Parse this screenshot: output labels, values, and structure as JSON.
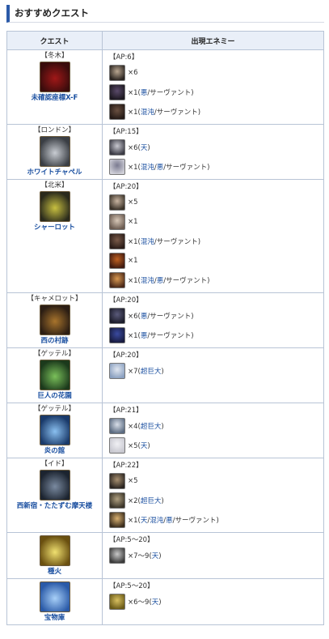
{
  "heading": "おすすめクエスト",
  "columns": {
    "quest": "クエスト",
    "enemy": "出現エネミー"
  },
  "rows": [
    {
      "region": "【冬木】",
      "name": "未確認座標X-F",
      "thumb_colors": [
        "#3a0c0c",
        "#a01818"
      ],
      "ap": "【AP:6】",
      "enemies": [
        {
          "icon": [
            "#2a2420",
            "#b9a690"
          ],
          "count": "×6",
          "cls": [],
          "suffix": ""
        },
        {
          "icon": [
            "#1c1820",
            "#5a4a6a"
          ],
          "count": "×1(",
          "cls": [
            "悪"
          ],
          "suffix": "/サーヴァント)"
        },
        {
          "icon": [
            "#241a16",
            "#6a5040"
          ],
          "count": "×1(",
          "cls": [
            "混沌"
          ],
          "suffix": "/サーヴァント)"
        }
      ]
    },
    {
      "region": "【ロンドン】",
      "name": "ホワイトチャペル",
      "thumb_colors": [
        "#3a3e44",
        "#c8ccd2"
      ],
      "ap": "【AP:15】",
      "enemies": [
        {
          "icon": [
            "#3a3a44",
            "#c8c8d0"
          ],
          "count": "×6(",
          "cls": [
            "天"
          ],
          "suffix": ")"
        },
        {
          "icon": [
            "#d0d0d8",
            "#7a7a90"
          ],
          "count": "×1(",
          "cls": [
            "混沌",
            "悪"
          ],
          "suffix": "/サーヴァント)"
        }
      ]
    },
    {
      "region": "【北米】",
      "name": "シャーロット",
      "thumb_colors": [
        "#2a2a1c",
        "#c8c040"
      ],
      "ap": "【AP:20】",
      "enemies": [
        {
          "icon": [
            "#3a3228",
            "#c8b4a0"
          ],
          "count": "×5",
          "cls": [],
          "suffix": ""
        },
        {
          "icon": [
            "#6a5a50",
            "#d8c8b8"
          ],
          "count": "×1",
          "cls": [],
          "suffix": ""
        },
        {
          "icon": [
            "#2a1c18",
            "#7a5a48"
          ],
          "count": "×1(",
          "cls": [
            "混沌"
          ],
          "suffix": "/サーヴァント)"
        },
        {
          "icon": [
            "#401a10",
            "#c06020"
          ],
          "count": "×1",
          "cls": [],
          "suffix": ""
        },
        {
          "icon": [
            "#4a2818",
            "#d89850"
          ],
          "count": "×1(",
          "cls": [
            "混沌",
            "悪"
          ],
          "suffix": "/サーヴァント)"
        }
      ]
    },
    {
      "region": "【キャメロット】",
      "name": "西の村跡",
      "thumb_colors": [
        "#2c1e14",
        "#a8742c"
      ],
      "ap": "【AP:20】",
      "enemies": [
        {
          "icon": [
            "#1c1c2a",
            "#5a5a7a"
          ],
          "count": "×6(",
          "cls": [
            "悪"
          ],
          "suffix": "/サーヴァント)"
        },
        {
          "icon": [
            "#181c40",
            "#3a4aa0"
          ],
          "count": "×1(",
          "cls": [
            "悪"
          ],
          "suffix": "/サーヴァント)"
        }
      ]
    },
    {
      "region": "【ゲッテル】",
      "name": "巨人の花園",
      "thumb_colors": [
        "#1c3a1c",
        "#7ac05a"
      ],
      "ap": "【AP:20】",
      "enemies": [
        {
          "icon": [
            "#8aa0c0",
            "#e0e6f0"
          ],
          "count": "×7(",
          "cls": [
            "超巨大"
          ],
          "suffix": ")"
        }
      ]
    },
    {
      "region": "【ゲッテル】",
      "name": "炎の館",
      "thumb_colors": [
        "#1a3a6a",
        "#8ac0f0"
      ],
      "ap": "【AP:21】",
      "enemies": [
        {
          "icon": [
            "#5a6a80",
            "#d8dee8"
          ],
          "count": "×4(",
          "cls": [
            "超巨大"
          ],
          "suffix": ")"
        },
        {
          "icon": [
            "#c8c8d0",
            "#f0f0f4"
          ],
          "count": "×5(",
          "cls": [
            "天"
          ],
          "suffix": ")"
        }
      ]
    },
    {
      "region": "【イド】",
      "name": "西新宿・たたずむ摩天楼",
      "thumb_colors": [
        "#1c2430",
        "#7a8aa0"
      ],
      "ap": "【AP:22】",
      "enemies": [
        {
          "icon": [
            "#2a2420",
            "#a89070"
          ],
          "count": "×5",
          "cls": [],
          "suffix": ""
        },
        {
          "icon": [
            "#3a3428",
            "#b0a080"
          ],
          "count": "×2(",
          "cls": [
            "超巨大"
          ],
          "suffix": ")"
        },
        {
          "icon": [
            "#3a2c1c",
            "#d8b070"
          ],
          "count": "×1(",
          "cls": [
            "天",
            "混沌",
            "悪"
          ],
          "suffix": "/サーヴァント)"
        }
      ]
    },
    {
      "region": "",
      "name": "種火",
      "thumb_colors": [
        "#6a5010",
        "#f0e070"
      ],
      "ap": "【AP:5～20】",
      "enemies": [
        {
          "icon": [
            "#3a3a3a",
            "#c8c8c8"
          ],
          "count": "×7～9(",
          "cls": [
            "天"
          ],
          "suffix": ")"
        }
      ]
    },
    {
      "region": "",
      "name": "宝物庫",
      "thumb_colors": [
        "#2a5aa8",
        "#a8d0f8"
      ],
      "ap": "【AP:5～20】",
      "enemies": [
        {
          "icon": [
            "#6a5a18",
            "#d8c060"
          ],
          "count": "×6～9(",
          "cls": [
            "天"
          ],
          "suffix": ")"
        }
      ]
    }
  ]
}
